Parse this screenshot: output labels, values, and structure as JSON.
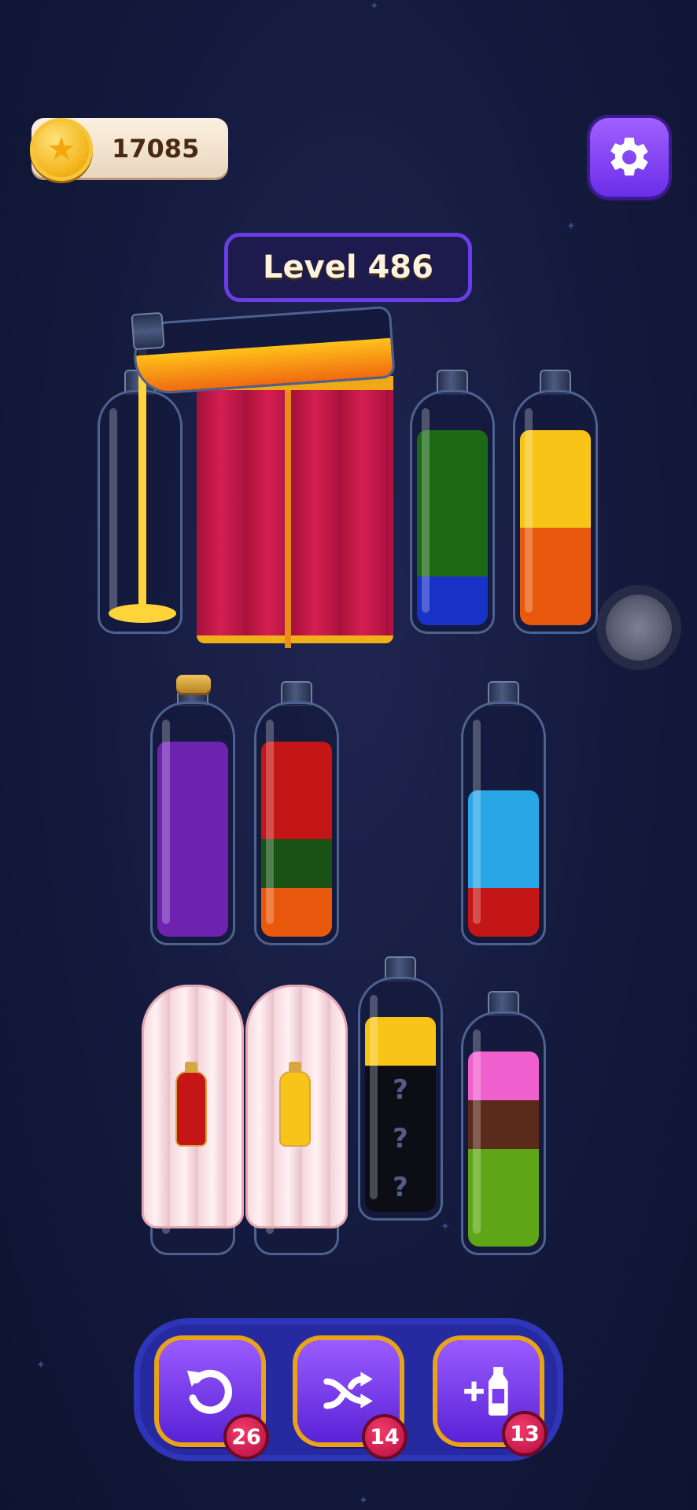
{
  "hud": {
    "coins": "17085",
    "level_label": "Level 486"
  },
  "colors": {
    "yellow": "#f8c417",
    "orange": "#e8580d",
    "green": "#1c6a16",
    "blue": "#1832c8",
    "purple": "#6e23b0",
    "red": "#c41616",
    "dark_green": "#195214",
    "light_blue": "#29a6e6",
    "pink": "#ef5fce",
    "brown": "#5a2a1a",
    "lime": "#5fa617",
    "black": "#0d0d16"
  },
  "bottles": {
    "row1": [
      {
        "id": "b1",
        "layers": [],
        "state": "receiving pour"
      },
      {
        "id": "b2",
        "layers": [],
        "state": "covered by curtain"
      },
      {
        "id": "b3",
        "layers": [
          "blue",
          "green",
          "green",
          "green"
        ]
      },
      {
        "id": "b4",
        "layers": [
          "orange",
          "orange",
          "yellow",
          "yellow"
        ]
      }
    ],
    "row2": [
      {
        "id": "b5",
        "layers": [
          "purple",
          "purple",
          "purple",
          "purple"
        ],
        "corked": true
      },
      {
        "id": "b6",
        "layers": [
          "orange",
          "dark_green",
          "red",
          "red"
        ]
      },
      {
        "id": "b7",
        "layers": [
          "red",
          "light_blue",
          "light_blue"
        ]
      }
    ],
    "row3": [
      {
        "id": "b8",
        "state": "covered by cloth",
        "hint_color": "red"
      },
      {
        "id": "b9",
        "state": "covered by cloth",
        "hint_color": "yellow"
      },
      {
        "id": "b10",
        "layers": [
          "hidden",
          "hidden",
          "hidden",
          "yellow"
        ],
        "hidden_mark": "?"
      },
      {
        "id": "b11",
        "layers": [
          "lime",
          "lime",
          "brown",
          "pink"
        ]
      }
    ]
  },
  "toolbar": {
    "undo": {
      "icon": "undo-icon",
      "count": "26"
    },
    "shuffle": {
      "icon": "shuffle-icon",
      "count": "14"
    },
    "add_bottle": {
      "icon": "add-bottle-icon",
      "count": "13"
    }
  }
}
